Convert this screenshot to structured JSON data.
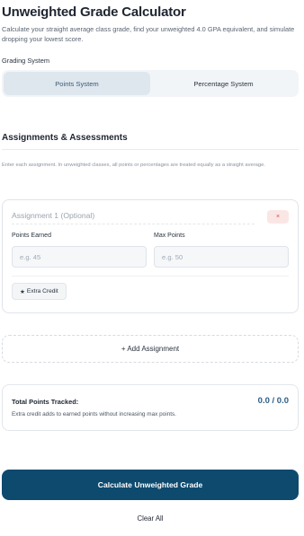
{
  "header": {
    "title": "Unweighted Grade Calculator",
    "subtitle": "Calculate your straight average class grade, find your unweighted 4.0 GPA equivalent, and simulate dropping your lowest score."
  },
  "grading": {
    "label": "Grading System",
    "options": [
      "Points System",
      "Percentage System"
    ],
    "selected": "Points System"
  },
  "assignments": {
    "heading": "Assignments & Assessments",
    "hint": "Enter each assignment. In unweighted classes, all points or percentages are treated equally as a straight average.",
    "items": [
      {
        "name_placeholder": "Assignment 1 (Optional)",
        "remove_label": "×",
        "earned_label": "Points Earned",
        "earned_placeholder": "e.g. 45",
        "max_label": "Max Points",
        "max_placeholder": "e.g. 50",
        "extra_credit_label": "Extra Credit",
        "extra_credit_icon": "star-icon"
      }
    ],
    "add_label": "+ Add Assignment"
  },
  "totals": {
    "label": "Total Points Tracked:",
    "value": "0.0 / 0.0",
    "note": "Extra credit adds to earned points without increasing max points."
  },
  "actions": {
    "calculate_label": "Calculate Unweighted Grade",
    "clear_label": "Clear All"
  },
  "colors": {
    "primary": "#0e4a6e",
    "accent_value": "#2a5d86",
    "remove_bg": "#fbe6e6",
    "toggle_active": "#dfe7ee"
  }
}
